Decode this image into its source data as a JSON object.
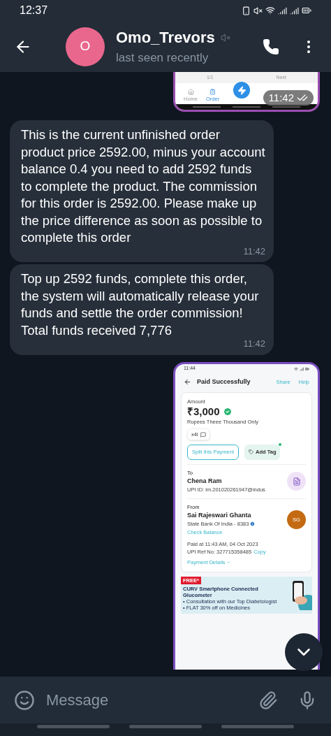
{
  "status_bar": {
    "time": "12:37"
  },
  "header": {
    "avatar_letter": "O",
    "name": "Omo_Trevors",
    "muted": true,
    "status": "last seen recently"
  },
  "messages": [
    {
      "time": "11:42",
      "read": true,
      "screen": {
        "kind": "order_tabbar",
        "pager": "1/1",
        "next": "Next",
        "tabs": [
          {
            "label": "Home",
            "selected": false
          },
          {
            "label": "Order",
            "selected": true
          }
        ]
      }
    },
    {
      "kind": "text",
      "text": "This is the current unfinished order product price 2592.00, minus your account balance 0.4 you need to add 2592 funds to complete the product. The commission for this order is 2592.00. Please make up the price difference as soon as possible to complete this order",
      "time": "11:42"
    },
    {
      "kind": "text",
      "text": "Top up 2592 funds, complete this order, the system will automatically release your funds and settle the order commission! Total funds received 7,776",
      "time": "11:42"
    },
    {
      "screen": {
        "kind": "payment",
        "time": "11:44",
        "title": "Paid Successfully",
        "actions": [
          "Share",
          "Help"
        ],
        "amount_label": "Amount",
        "amount": "₹3,000",
        "amount_words": "Rupees Theee Thousand Only",
        "chip": "x4l",
        "buttons": [
          {
            "kind": "outline",
            "label": "Split this Payment"
          },
          {
            "kind": "tag",
            "label": "Add Tag"
          }
        ],
        "to": {
          "label": "To",
          "name": "Chena Ram",
          "detail": "UPI ID: im.201020261947@indus"
        },
        "from": {
          "label": "From",
          "name": "Sai Rajeswari Ghanta",
          "bank": "State Bank Of India - 8383",
          "link": "Check Balance",
          "initials": "SG"
        },
        "paid_at": "Paid at 11:43 AM, 04 Oct 2023",
        "ref": "UPI Ref No: 327715358485",
        "copy": "Copy",
        "details": "Payment Details",
        "ad": {
          "badge": "FREE*",
          "title": "CURV Smartphone Connected Glucometer",
          "bullets": [
            "• Consultation with our Top Diabetologist",
            "• FLAT 30% off on Medicines"
          ]
        }
      }
    }
  ],
  "input": {
    "placeholder": "Message"
  }
}
